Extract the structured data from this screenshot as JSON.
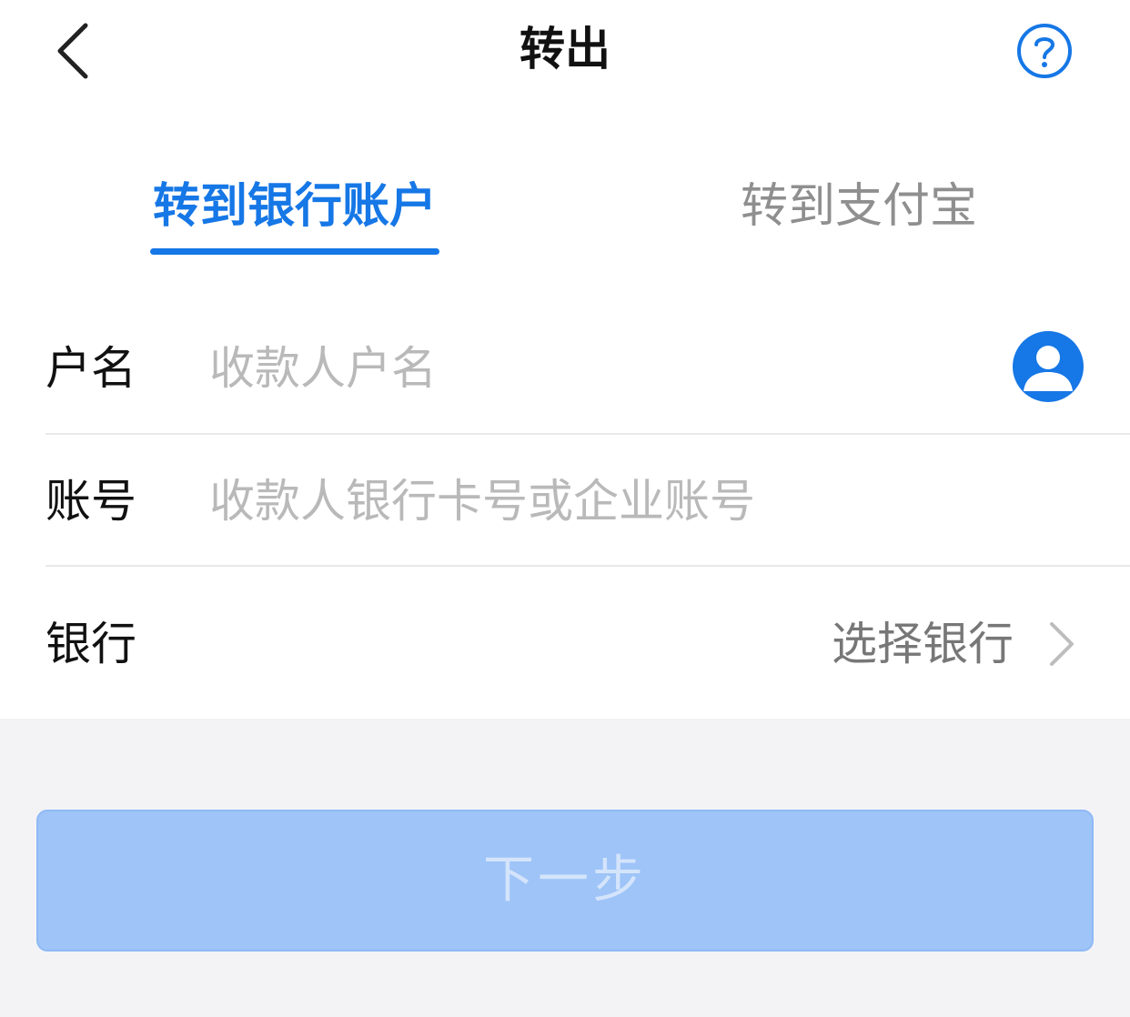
{
  "nav": {
    "title": "转出",
    "back_icon": "chevron-left-icon",
    "help_icon": "question-circle-icon"
  },
  "tabs": [
    {
      "label": "转到银行账户",
      "active": true
    },
    {
      "label": "转到支付宝",
      "active": false
    }
  ],
  "form": {
    "name": {
      "label": "户名",
      "placeholder": "收款人户名",
      "value": "",
      "action_icon": "contact-person-icon"
    },
    "account": {
      "label": "账号",
      "placeholder": "收款人银行卡号或企业账号",
      "value": ""
    },
    "bank": {
      "label": "银行",
      "select_label": "选择银行",
      "chevron_icon": "chevron-right-icon"
    }
  },
  "next_button": {
    "label": "下一步",
    "enabled": false
  },
  "colors": {
    "accent": "#1677e6",
    "tab_inactive": "#8f8f8f",
    "placeholder": "#b9b9b9",
    "button_disabled_bg": "#9ec4f8",
    "button_disabled_text": "#d4e4fb",
    "page_bg": "#f3f3f6",
    "card_bg": "#ffffff"
  }
}
